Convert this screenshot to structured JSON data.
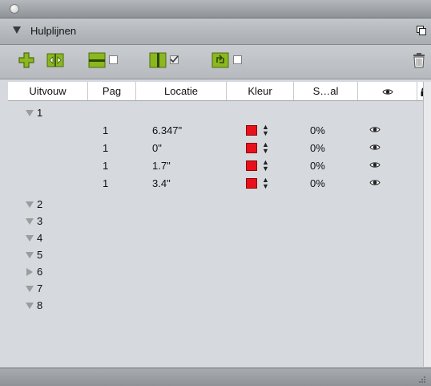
{
  "panel": {
    "title": "Hulplijnen"
  },
  "toolbar": {
    "icons": [
      "add-guide-icon",
      "guide-manager-icon",
      "horizontal-guides-icon",
      "vertical-guides-icon",
      "locked-guides-icon",
      "delete-icon"
    ]
  },
  "table": {
    "columns": [
      "Uitvouw",
      "Pag",
      "Locatie",
      "Kleur",
      "S...al",
      "eye-icon",
      "lock-icon"
    ],
    "col_label_expand": "Uitvouw",
    "col_label_page": "Pag",
    "col_label_location": "Locatie",
    "col_label_color": "Kleur",
    "col_label_scale": "S…al",
    "groups": [
      {
        "num": "1",
        "expanded": true,
        "rows": [
          {
            "page": "1",
            "location": "6.347\"",
            "color": "#e8111b",
            "scale": "0%"
          },
          {
            "page": "1",
            "location": "0\"",
            "color": "#e8111b",
            "scale": "0%"
          },
          {
            "page": "1",
            "location": "1.7\"",
            "color": "#e8111b",
            "scale": "0%"
          },
          {
            "page": "1",
            "location": "3.4\"",
            "color": "#e8111b",
            "scale": "0%"
          }
        ]
      },
      {
        "num": "2",
        "expanded": true
      },
      {
        "num": "3",
        "expanded": true
      },
      {
        "num": "4",
        "expanded": true
      },
      {
        "num": "5",
        "expanded": true
      },
      {
        "num": "6",
        "expanded": false
      },
      {
        "num": "7",
        "expanded": true
      },
      {
        "num": "8",
        "expanded": true
      }
    ]
  },
  "colors": {
    "panel_bg": "#d6d9de",
    "swatch_red": "#e8111b",
    "toolbar_green": "#8ab81e"
  }
}
